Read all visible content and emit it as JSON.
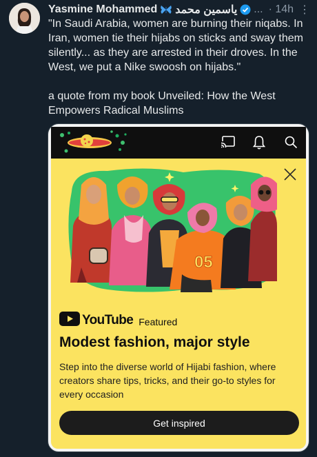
{
  "author": {
    "name": "Yasmine Mohammed",
    "arabic_name": "ياسمين محمد",
    "ellipsis": "...",
    "time": "· 14h",
    "more": "⋮"
  },
  "tweet": {
    "paragraph1": "\"In Saudi Arabia, women are burning their niqabs. In Iran, women tie their hijabs on sticks and sway them silently... as they are arrested in their droves. In the West, we put a Nike swoosh on hijabs.\"",
    "paragraph2": "a quote from my book Unveiled: How the West Empowers Radical Muslims"
  },
  "promo": {
    "brand": "YouTube",
    "featured": "Featured",
    "title": "Modest fashion, major style",
    "description": "Step into the diverse world of Hijabi fashion, where creators share tips, tricks, and their go-to styles for every occasion",
    "cta": "Get inspired",
    "jersey_number": "05"
  },
  "colors": {
    "background": "#15202b",
    "panel": "#fbe360",
    "verified": "#1d9bf0",
    "youtube_red": "#ff0000"
  },
  "icons": [
    "butterfly-icon",
    "verified-icon",
    "more-icon",
    "cast-icon",
    "bell-icon",
    "search-icon",
    "close-icon",
    "youtube-logo-icon"
  ]
}
